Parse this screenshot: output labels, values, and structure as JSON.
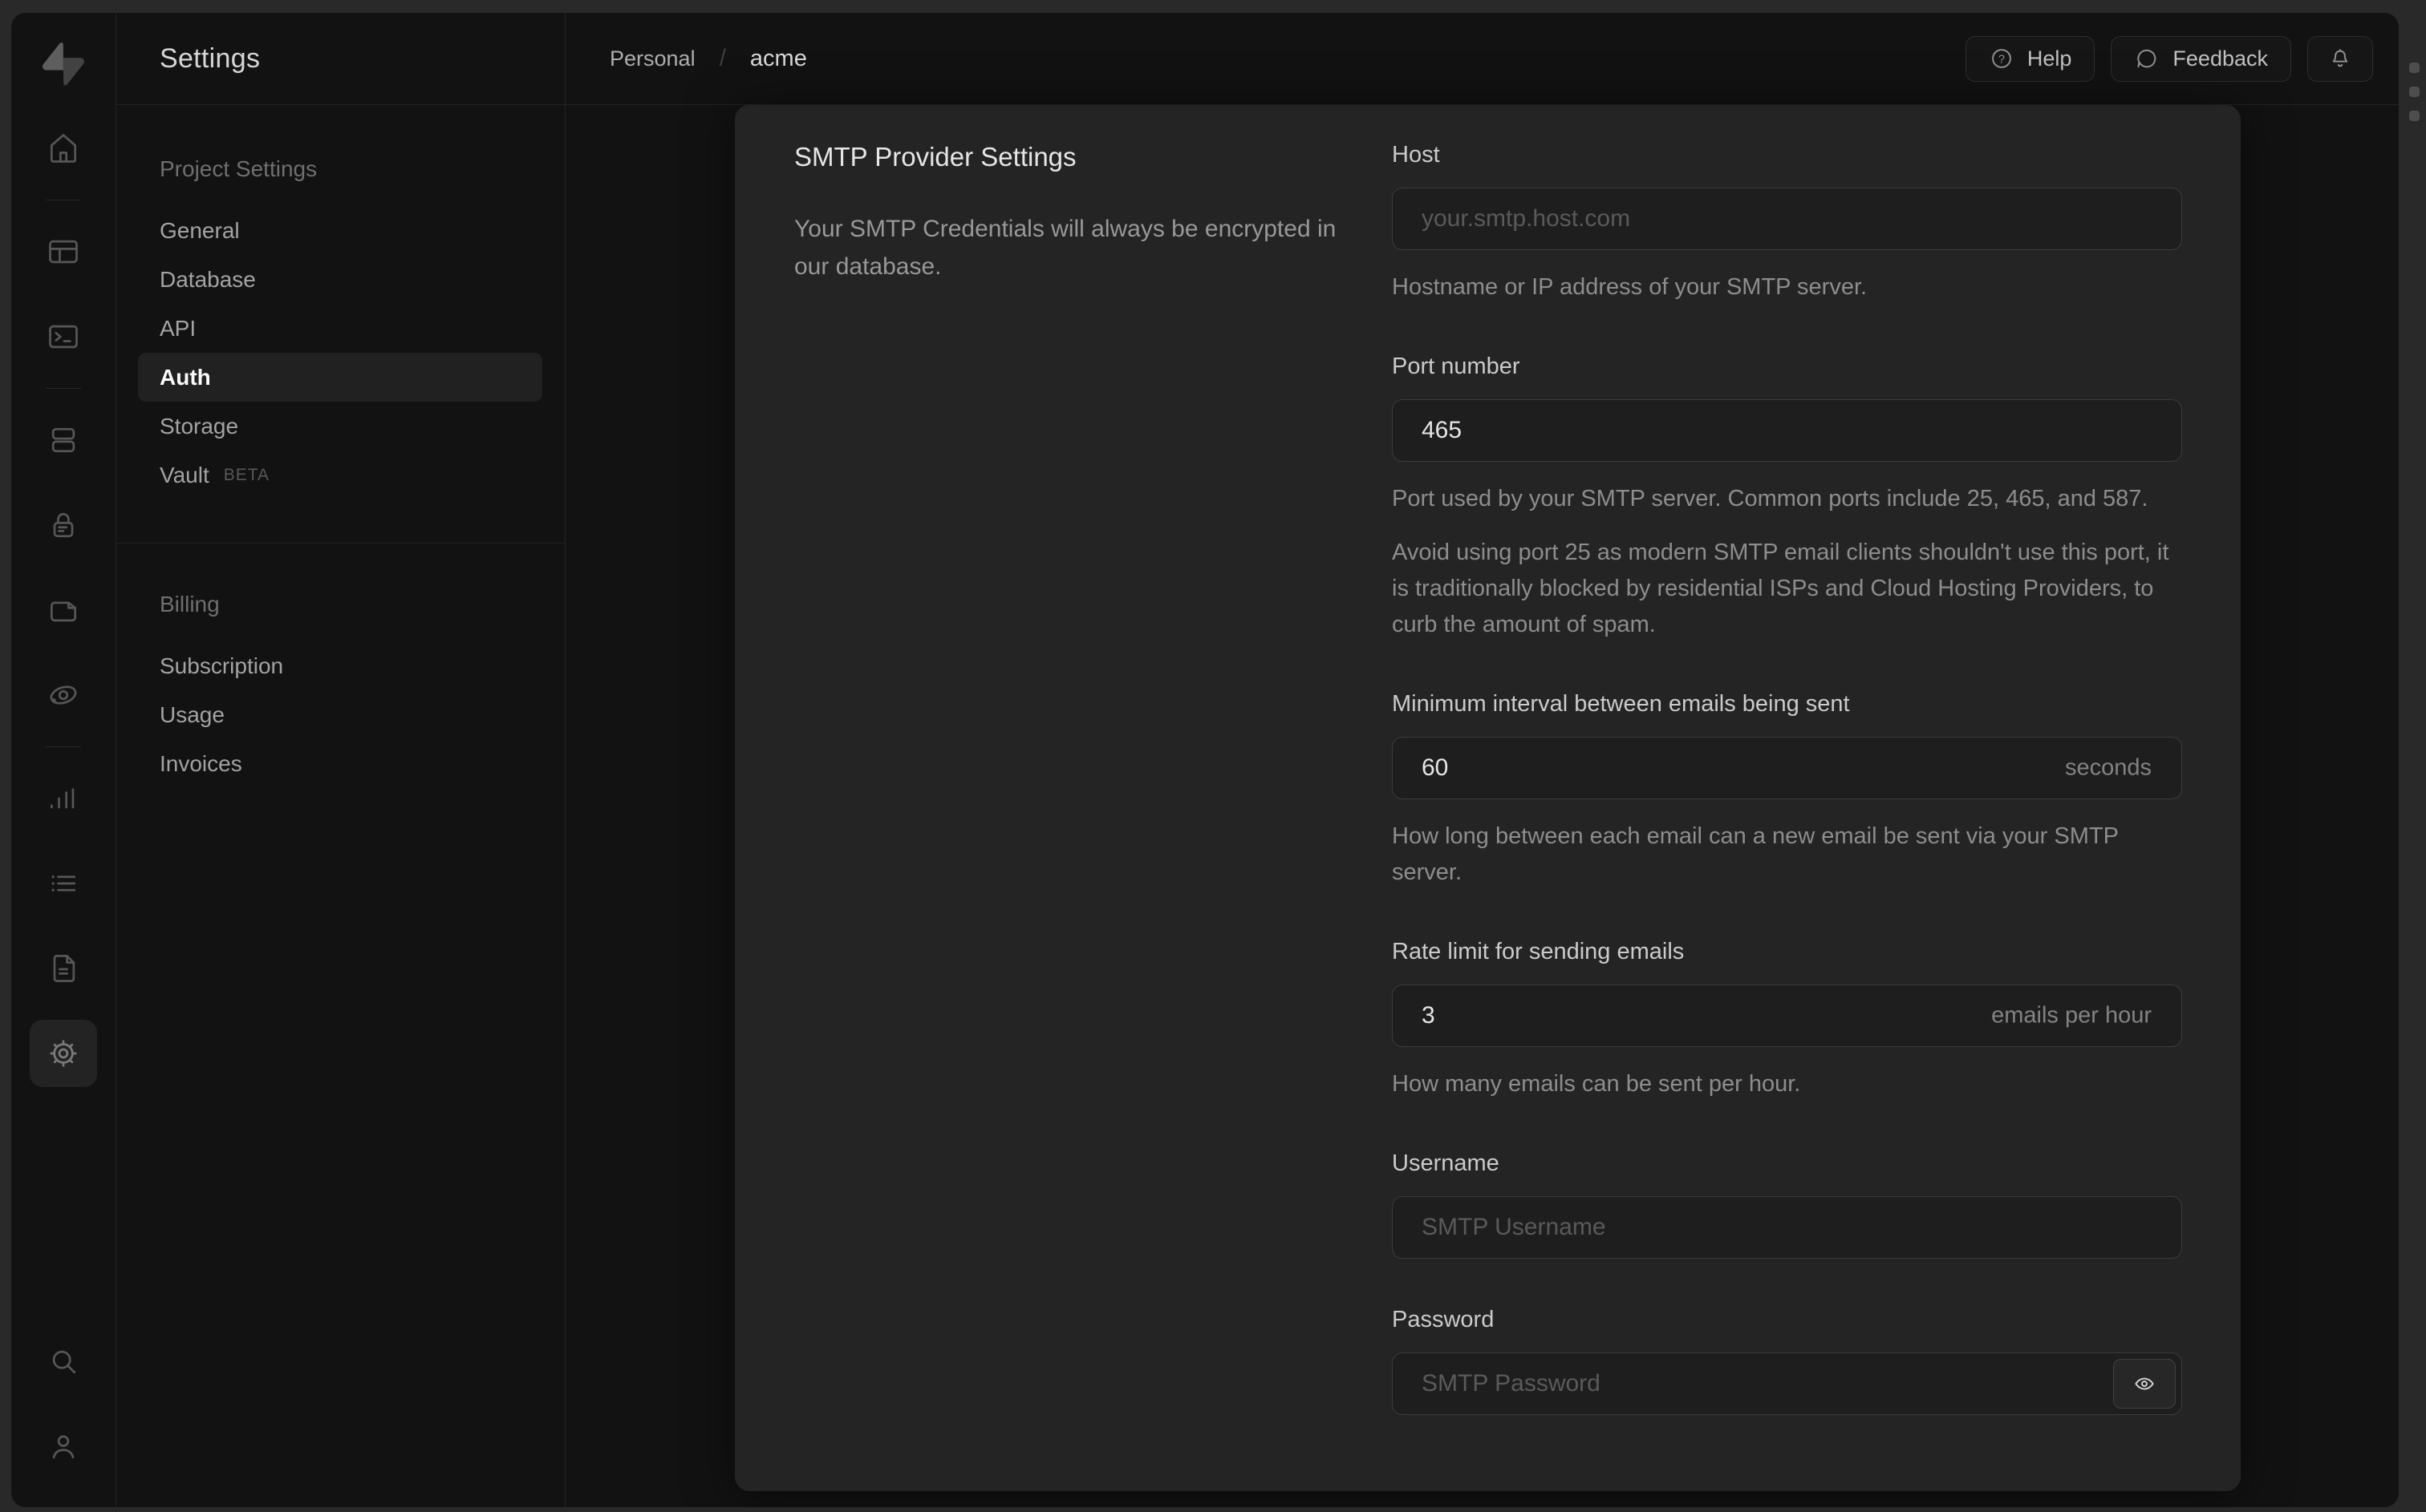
{
  "window": {
    "colors": {
      "outer_bg": "#292929",
      "window_bg": "#121212",
      "panel_bg": "#242424",
      "input_bg": "#1e1e1e",
      "border": "#2d2d2d",
      "text_primary": "#e6e6e6",
      "text_secondary": "#8d8d8d"
    }
  },
  "rail": {
    "icons": [
      "supabase-logo",
      "home-icon",
      "table-editor-icon",
      "sql-editor-icon",
      "database-icon",
      "auth-icon",
      "storage-icon",
      "edge-functions-icon",
      "reports-icon",
      "logs-icon",
      "api-docs-icon",
      "settings-icon",
      "search-icon",
      "profile-icon"
    ]
  },
  "menu": {
    "title": "Settings",
    "sections": [
      {
        "label": "Project Settings",
        "items": [
          {
            "label": "General"
          },
          {
            "label": "Database"
          },
          {
            "label": "API"
          },
          {
            "label": "Auth",
            "active": true
          },
          {
            "label": "Storage"
          },
          {
            "label": "Vault",
            "badge": "BETA"
          }
        ]
      },
      {
        "label": "Billing",
        "items": [
          {
            "label": "Subscription"
          },
          {
            "label": "Usage"
          },
          {
            "label": "Invoices"
          }
        ]
      }
    ]
  },
  "topbar": {
    "breadcrumb": {
      "org": "Personal",
      "separator": "/",
      "project": "acme"
    },
    "help_label": "Help",
    "feedback_label": "Feedback"
  },
  "panel": {
    "title": "SMTP Provider Settings",
    "description": "Your SMTP Credentials will always be encrypted in our database.",
    "fields": {
      "host": {
        "label": "Host",
        "placeholder": "your.smtp.host.com",
        "help": "Hostname or IP address of your SMTP server."
      },
      "port": {
        "label": "Port number",
        "value": "465",
        "help": "Port used by your SMTP server. Common ports include 25, 465, and 587.",
        "help2": "Avoid using port 25 as modern SMTP email clients shouldn't use this port, it is traditionally blocked by residential ISPs and Cloud Hosting Providers, to curb the amount of spam."
      },
      "interval": {
        "label": "Minimum interval between emails being sent",
        "value": "60",
        "suffix": "seconds",
        "help": "How long between each email can a new email be sent via your SMTP server."
      },
      "rate": {
        "label": "Rate limit for sending emails",
        "value": "3",
        "suffix": "emails per hour",
        "help": "How many emails can be sent per hour."
      },
      "username": {
        "label": "Username",
        "placeholder": "SMTP Username"
      },
      "password": {
        "label": "Password",
        "placeholder": "SMTP Password"
      }
    }
  }
}
